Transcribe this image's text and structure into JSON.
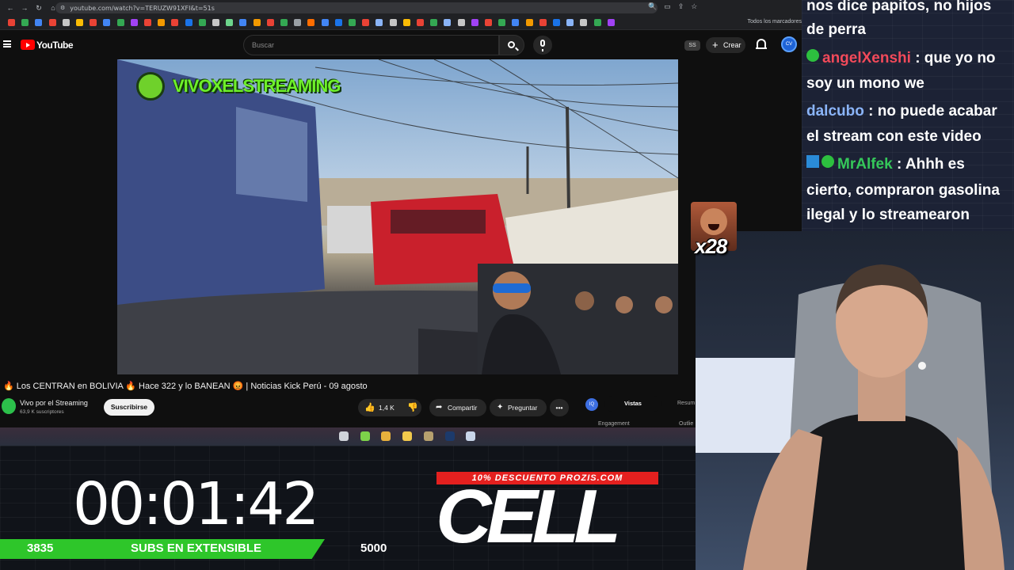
{
  "browser": {
    "url": "youtube.com/watch?v=TERUZW91XFI&t=51s",
    "bookmarks_all": "Todos los marcadores",
    "bookmark_colors": [
      "#e94235",
      "#34a853",
      "#4285f4",
      "#ea4335",
      "#c6c6c6",
      "#fbbc05",
      "#ea4335",
      "#4285f4",
      "#34a853",
      "#a142f4",
      "#ea4335",
      "#f29900",
      "#e94235",
      "#1a73e8",
      "#34a853",
      "#c6c6c6",
      "#6dd58c",
      "#4285f4",
      "#f29900",
      "#e94235",
      "#34a853",
      "#9aa0a6",
      "#ff6d00",
      "#4285f4",
      "#1a73e8",
      "#34a853",
      "#e94235",
      "#8ab4f8",
      "#c6c6c6",
      "#fbbc05",
      "#e94235",
      "#34a853",
      "#8ab4f8",
      "#c6c6c6",
      "#a142f4",
      "#ea4335",
      "#34a853",
      "#4285f4",
      "#f29900",
      "#e94235",
      "#1a73e8",
      "#8ab4f8",
      "#c6c6c6",
      "#34a853",
      "#a142f4"
    ]
  },
  "youtube": {
    "brand": "YouTube",
    "search_placeholder": "Buscar",
    "ss_badge": "SS",
    "create_label": "Crear",
    "avatar_text": "CV",
    "watermark": "VIVOXELSTREAMING",
    "video_title": "🔥 Los CENTRAN en BOLIVIA 🔥 Hace 322 y lo BANEAN 😡 | Noticias Kick Perú - 09 agosto",
    "channel_name": "Vivo por el Streaming",
    "channel_subs": "63,9 K suscriptores",
    "subscribe_label": "Suscribirse",
    "likes": "1,4 K",
    "share_label": "Compartir",
    "ask_label": "Preguntar",
    "more_label": "•••",
    "side_panel": {
      "icon_text": "IQ",
      "tab_active": "Vistas",
      "tab_other": "Resum",
      "engagement": "Engagement",
      "outlier": "Outlie"
    }
  },
  "taskbar_icons": [
    {
      "name": "browser-taskbar-icon",
      "color": "#d0d3da"
    },
    {
      "name": "app-green-taskbar-icon",
      "color": "#7dd34a"
    },
    {
      "name": "chrome-taskbar-icon",
      "color": "#e8b03c"
    },
    {
      "name": "folder-taskbar-icon",
      "color": "#f2c94c"
    },
    {
      "name": "app-diamond-taskbar-icon",
      "color": "#b7a06e"
    },
    {
      "name": "photoshop-taskbar-icon",
      "color": "#1c3a6b"
    },
    {
      "name": "app-globe-taskbar-icon",
      "color": "#c9d6ea"
    }
  ],
  "overlay": {
    "timer": "00:01:42",
    "subs_current": "3835",
    "subs_label": "SUBS EN EXTENSIBLE",
    "subs_goal": "5000",
    "promo": "10% DESCUENTO PROZIS.COM",
    "logo": "CELL"
  },
  "chat": {
    "lines": [
      {
        "text": "nos dice papitos, no hijos"
      },
      {
        "text": "de perra"
      },
      {
        "user": "angelXenshi",
        "text": " : que yo no"
      },
      {
        "text": "soy un mono we"
      },
      {
        "user": "dalcubo",
        "text": " : no puede acabar"
      },
      {
        "text": "el stream con este video"
      },
      {
        "user": "MrAlfek",
        "text": " : Ahhh es"
      },
      {
        "text": "cierto, compraron gasolina"
      },
      {
        "text": "ilegal y lo streamearon"
      }
    ],
    "emote_count": "x28"
  },
  "colors": {
    "youtube_red": "#ff0000",
    "subs_bar": "#2ec62a",
    "promo_red": "#e4201f",
    "chat_green": "#35c85a",
    "chat_red": "#f34a5a",
    "chat_blue": "#8ab4f8"
  }
}
